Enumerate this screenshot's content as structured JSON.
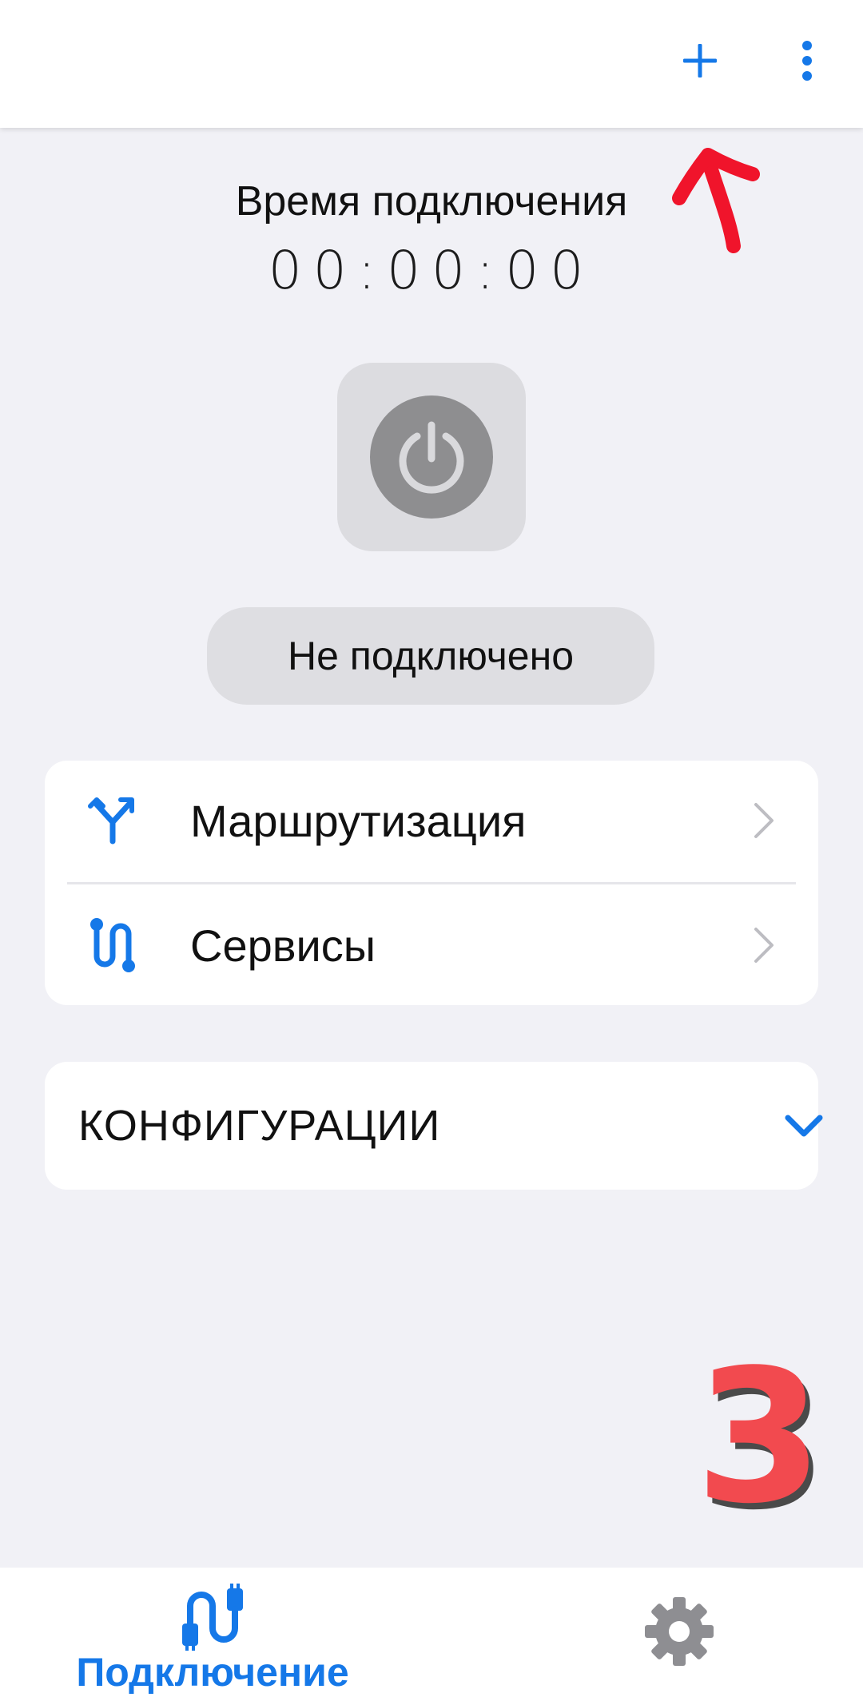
{
  "appbar": {
    "add_icon": "plus-icon",
    "more_icon": "more-vert-icon"
  },
  "timer": {
    "label": "Время подключения",
    "value": "00:00:00"
  },
  "power": {
    "icon": "power-icon"
  },
  "status": {
    "text": "Не подключено"
  },
  "menu": {
    "items": [
      {
        "label": "Маршрутизация",
        "icon": "routing-icon"
      },
      {
        "label": "Сервисы",
        "icon": "services-icon"
      }
    ]
  },
  "configurations": {
    "label": "КОНФИГУРАЦИИ",
    "icon": "chevron-down-icon"
  },
  "annotation": {
    "step": "3"
  },
  "bottom_nav": {
    "connection_label": "Подключение",
    "connection_icon": "connection-icon",
    "settings_icon": "gear-icon"
  },
  "colors": {
    "accent": "#1578E8",
    "background": "#F1F1F6",
    "power_bg": "#DCDCE0",
    "power_circle": "#8E8E90",
    "annotation": "#F24A4F"
  }
}
